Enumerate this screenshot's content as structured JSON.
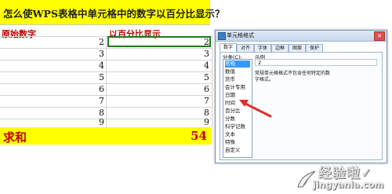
{
  "sheet": {
    "title": "怎么使WPS表格中单元格中的数字以百分比显示？",
    "col_a_header": "原始数字",
    "col_b_header": "以百分比显示",
    "rows": [
      {
        "a": "2",
        "b": "2"
      },
      {
        "a": "3",
        "b": "3"
      },
      {
        "a": "4",
        "b": "4"
      },
      {
        "a": "5",
        "b": "5"
      },
      {
        "a": "6",
        "b": "6"
      },
      {
        "a": "7",
        "b": "7"
      },
      {
        "a": "8",
        "b": "8"
      },
      {
        "a": "9",
        "b": "9"
      },
      {
        "a": "10",
        "b": "10"
      }
    ],
    "total_label": "求和",
    "total_value": "54",
    "highlight_color": "#ffff00",
    "header_color": "#c00000"
  },
  "dialog": {
    "title": "单元格格式",
    "close_icon": "close-icon",
    "tabs": [
      "数字",
      "对齐",
      "字体",
      "边框",
      "图案",
      "保护"
    ],
    "active_tab": "数字",
    "category_label": "分类(C):",
    "categories": [
      "常规",
      "数值",
      "货币",
      "会计专用",
      "日期",
      "时间",
      "百分比",
      "分数",
      "科学记数",
      "文本",
      "特殊",
      "自定义"
    ],
    "selected_category": "常规",
    "sample_label": "示例",
    "sample_value": "2",
    "description": "常规单元格格式不包含任何特定的数字格式。"
  },
  "annotation": {
    "arrow_target": "百分比",
    "arrow_color": "#e03030"
  },
  "watermark": {
    "text": "经验啦",
    "check_mark": "✓",
    "url": "jingyanla.com"
  }
}
